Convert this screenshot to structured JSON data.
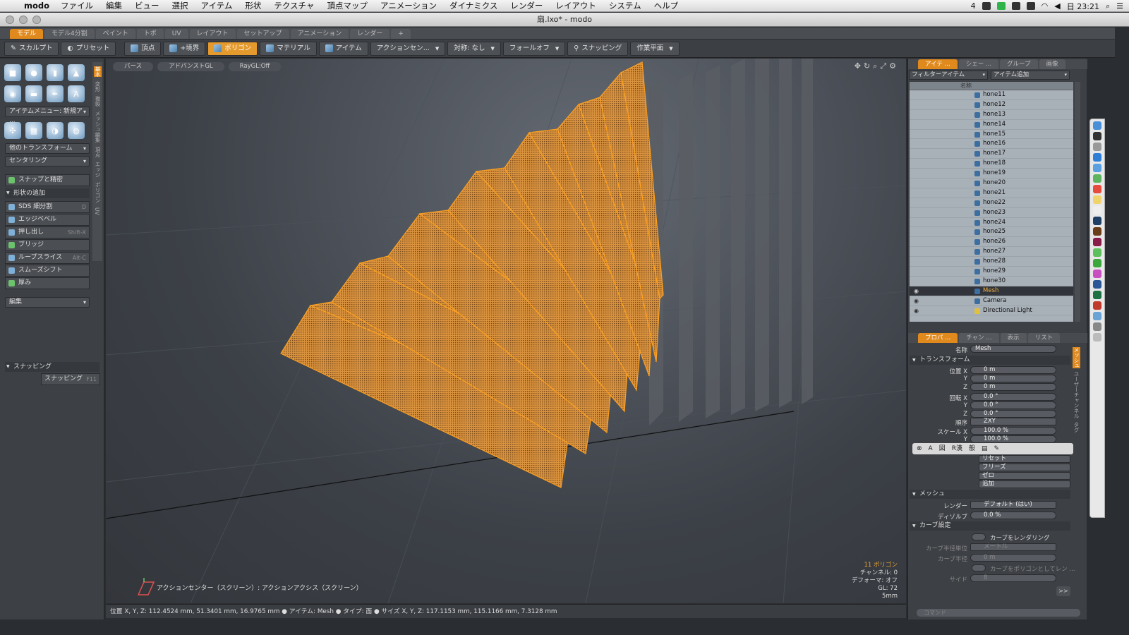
{
  "os_menu": {
    "app": "modo",
    "items": [
      "ファイル",
      "編集",
      "ビュー",
      "選択",
      "アイテム",
      "形状",
      "テクスチャ",
      "頂点マップ",
      "アニメーション",
      "ダイナミクス",
      "レンダー",
      "レイアウト",
      "システム",
      "ヘルプ"
    ],
    "status": {
      "badge": "4",
      "clock": "日 23:21"
    }
  },
  "window": {
    "title": "扇.lxo* - modo"
  },
  "layout_tabs": [
    "モデル",
    "モデル4分割",
    "ペイント",
    "トポ",
    "UV",
    "レイアウト",
    "セットアップ",
    "アニメーション",
    "レンダー",
    "+"
  ],
  "toolbar": {
    "sculpt": "スカルプト",
    "preset": "プリセット",
    "vertex": "頂点",
    "edge": "+境界",
    "polygon": "ポリゴン",
    "material": "マテリアル",
    "item": "アイテム",
    "action_center": "アクションセン...",
    "symmetry": "対称: なし",
    "falloff": "フォールオフ",
    "snapping": "スナッピング",
    "work_plane": "作業平面"
  },
  "left_panel": {
    "item_menu": "アイテムメニュー: 新規ア ...",
    "other_transform": "他のトランスフォーム",
    "centering": "センタリング",
    "snap_precision": "スナップと精密",
    "add_shape": "形状の追加",
    "tools": [
      {
        "label": "SDS 細分割",
        "shortcut": "D"
      },
      {
        "label": "エッジベベル",
        "shortcut": ""
      },
      {
        "label": "押し出し",
        "shortcut": "Shift-X"
      },
      {
        "label": "ブリッジ",
        "shortcut": ""
      },
      {
        "label": "ループスライス",
        "shortcut": "Alt-C"
      },
      {
        "label": "スムーズシフト",
        "shortcut": ""
      },
      {
        "label": "厚み",
        "shortcut": ""
      }
    ],
    "edit": "編集",
    "snapping_header": "スナッピング",
    "snapping_button": "スナッピング",
    "snapping_shortcut": "F11",
    "vertical_tabs": [
      "基本",
      "変形",
      "複製",
      "メッシュ編集",
      "頂点",
      "エッジ",
      "ポリゴン",
      "UV"
    ]
  },
  "viewport": {
    "tabs": [
      "パース",
      "アドバンストGL",
      "RayGL:Off"
    ],
    "stats": [
      "11 ポリゴン",
      "チャンネル: 0",
      "デフォーマ: オフ",
      "GL: 72",
      "5mm"
    ],
    "action_text": "アクションセンター（スクリーン）: アクションアクシス（スクリーン）"
  },
  "status_bar": "位置 X, Y, Z:   112.4524 mm, 51.3401 mm, 16.9765 mm ● アイテム: Mesh ● タイプ: 面 ● サイズ X, Y, Z:   117.1153 mm, 115.1166 mm, 7.3128 mm",
  "item_panel": {
    "tabs": [
      "アイテ ...",
      "シェー ...",
      "グループ",
      "画像"
    ],
    "filter": "フィルターアイテム",
    "add_item": "アイテム追加",
    "name_header": "名称",
    "items": [
      "hone11",
      "hone12",
      "hone13",
      "hone14",
      "hone15",
      "hone16",
      "hone17",
      "hone18",
      "hone19",
      "hone20",
      "hone21",
      "hone22",
      "hone23",
      "hone24",
      "hone25",
      "hone26",
      "hone27",
      "hone28",
      "hone29",
      "hone30",
      "Mesh",
      "Camera",
      "Directional Light"
    ],
    "selected": "Mesh"
  },
  "properties": {
    "tabs": [
      "プロパ ...",
      "チャン ...",
      "表示",
      "リスト"
    ],
    "name_label": "名称",
    "name_value": "Mesh",
    "transform_header": "トランスフォーム",
    "position": {
      "label_x": "位置 X",
      "label_y": "Y",
      "label_z": "Z",
      "x": "0 m",
      "y": "0 m",
      "z": "0 m"
    },
    "rotation": {
      "label_x": "回転 X",
      "label_y": "Y",
      "label_z": "Z",
      "x": "0.0 °",
      "y": "0.0 °",
      "z": "0.0 °"
    },
    "order_label": "順序",
    "order_value": "ZXY",
    "scale_label": "スケール X",
    "scale_x": "100.0 %",
    "scale_y_label": "Y",
    "scale_y": "100.0 %",
    "actions": [
      "リセット",
      "フリーズ",
      "ゼロ",
      "追加"
    ],
    "mesh_header": "メッシュ",
    "render_label": "レンダー",
    "render_value": "デフォルト (はい)",
    "dissolve_label": "ディゾルブ",
    "dissolve_value": "0.0 %",
    "curve_header": "カーブ設定",
    "render_curves": "カーブをレンダリング",
    "curve_radius_unit_label": "カーブ半径単位",
    "curve_radius_unit_value": "メートル",
    "curve_radius_label": "カーブ半径",
    "curve_radius_value": "0 m",
    "curve_as_polygon": "カーブをポリゴンとしてレン ...",
    "sides_label": "サイド",
    "sides_value": "8",
    "more": ">>",
    "command_placeholder": "コマンド",
    "vertical_tabs": [
      "メッシュ",
      "ユーザーチャンネル",
      "タグ"
    ]
  },
  "ime_toolbar": [
    "A",
    "図",
    "R漢",
    "般"
  ],
  "colors": {
    "accent": "#e08a1e",
    "selection": "#f0a030",
    "viewport_bg": "#3c4047"
  }
}
